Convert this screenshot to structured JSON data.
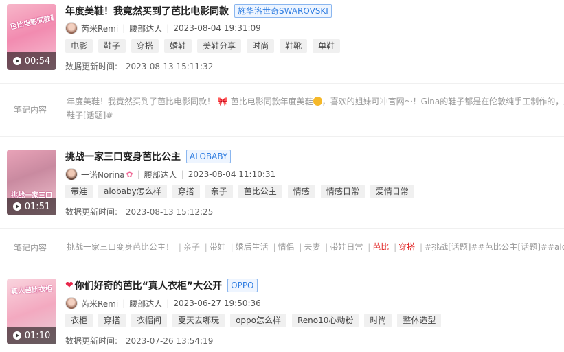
{
  "notes": [
    {
      "thumb_caption": "芭比电影同款鞋",
      "duration": "00:54",
      "title": "年度美鞋！我竟然买到了芭比电影同款",
      "brand": "施华洛世奇SWAROVSKI",
      "author": "芮米Remi",
      "level": "腰部达人",
      "published": "2023-08-04 19:31:09",
      "tags": [
        "电影",
        "鞋子",
        "穿搭",
        "婚鞋",
        "美鞋分享",
        "时尚",
        "鞋靴",
        "单鞋"
      ],
      "update_label": "数据更新时间:",
      "update_time": "2023-08-13 15:11:32"
    },
    {
      "thumb_caption": "挑战一家三口",
      "duration": "01:51",
      "title": "挑战一家三口变身芭比公主",
      "brand": "ALOBABY",
      "author": "一诺Norina",
      "level": "腰部达人",
      "published": "2023-08-04 11:10:31",
      "tags": [
        "带娃",
        "alobaby怎么样",
        "穿搭",
        "亲子",
        "芭比公主",
        "情感",
        "情感日常",
        "爱情日常"
      ],
      "update_label": "数据更新时间:",
      "update_time": "2023-08-13 15:12:25"
    },
    {
      "thumb_caption": "真人芭比衣柜",
      "duration": "01:10",
      "title": "你们好奇的芭比“真人衣柜”大公开",
      "brand": "OPPO",
      "author": "芮米Remi",
      "level": "腰部达人",
      "published": "2023-06-27 19:50:36",
      "tags": [
        "衣柜",
        "穿搭",
        "衣帽间",
        "夏天去哪玩",
        "oppo怎么样",
        "Reno10心动粉",
        "时尚",
        "整体造型"
      ],
      "update_label": "数据更新时间:",
      "update_time": "2023-07-26 13:54:19"
    }
  ],
  "content1": {
    "label": "笔记内容",
    "part1": "年度美鞋！我竟然买到了芭比电影同款！",
    "part2": "芭比电影同款年度美鞋",
    "part3": "，喜欢的姐妹可冲官网～！Gina的鞋子都是在伦敦纯手工制作的，后",
    "line2": "鞋子[话题]#"
  },
  "content2": {
    "label": "笔记内容",
    "prefix": "挑战一家三口变身芭比公主！",
    "kw": [
      "亲子",
      "带娃",
      "婚后生活",
      "情侣",
      "夫妻",
      "带娃日常"
    ],
    "hl": [
      "芭比",
      "穿搭"
    ],
    "suffix": "#挑战[话题]##芭比公主[话题]##alobaby"
  },
  "colors": {
    "brand_blue": "#2f7de1",
    "highlight_red": "#e02020",
    "tag_bg": "#f0f0f0"
  }
}
